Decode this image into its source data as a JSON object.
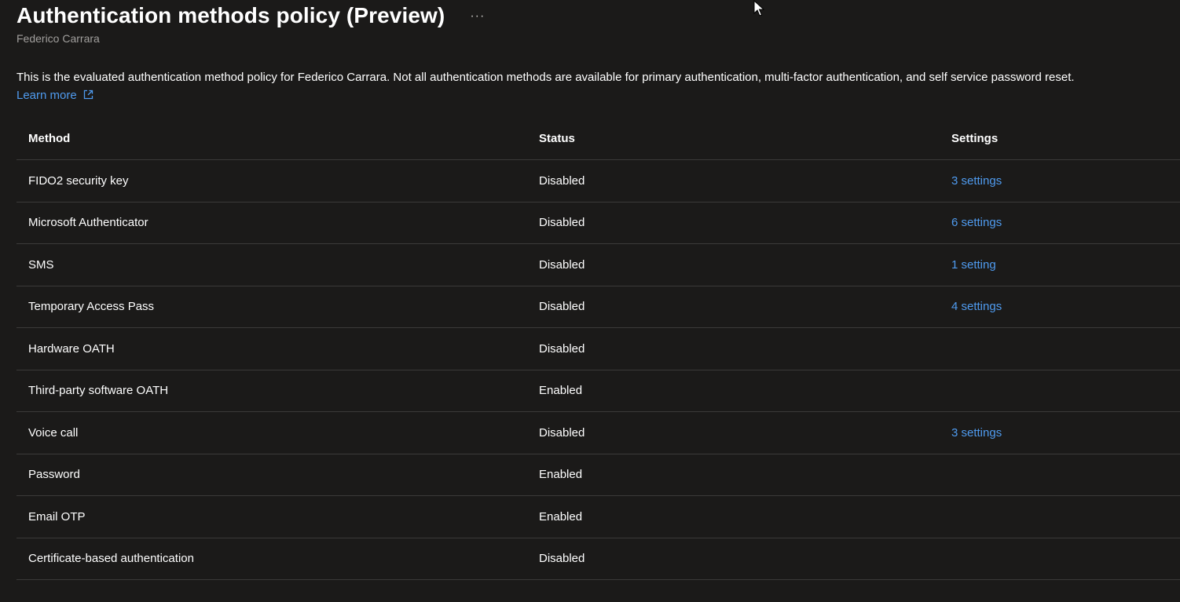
{
  "header": {
    "title": "Authentication methods policy (Preview)",
    "more_label": "···",
    "subtitle": "Federico Carrara"
  },
  "description": {
    "text": "This is the evaluated authentication method policy for Federico Carrara. Not all authentication methods are available for primary authentication, multi-factor authentication, and self service password reset.",
    "learn_more": "Learn more"
  },
  "table": {
    "columns": [
      "Method",
      "Status",
      "Settings"
    ],
    "rows": [
      {
        "method": "FIDO2 security key",
        "status": "Disabled",
        "settings": "3 settings"
      },
      {
        "method": "Microsoft Authenticator",
        "status": "Disabled",
        "settings": "6 settings"
      },
      {
        "method": "SMS",
        "status": "Disabled",
        "settings": "1 setting"
      },
      {
        "method": "Temporary Access Pass",
        "status": "Disabled",
        "settings": "4 settings"
      },
      {
        "method": "Hardware OATH",
        "status": "Disabled",
        "settings": ""
      },
      {
        "method": "Third-party software OATH",
        "status": "Enabled",
        "settings": ""
      },
      {
        "method": "Voice call",
        "status": "Disabled",
        "settings": "3 settings"
      },
      {
        "method": "Password",
        "status": "Enabled",
        "settings": ""
      },
      {
        "method": "Email OTP",
        "status": "Enabled",
        "settings": ""
      },
      {
        "method": "Certificate-based authentication",
        "status": "Disabled",
        "settings": ""
      }
    ]
  },
  "colors": {
    "background": "#1b1a19",
    "link": "#4f9bef",
    "divider": "#3b3a39",
    "subtitle": "#a19f9d"
  },
  "icons": {
    "more": "more-horizontal-icon",
    "external_link": "external-link-icon",
    "cursor": "mouse-pointer-icon"
  }
}
